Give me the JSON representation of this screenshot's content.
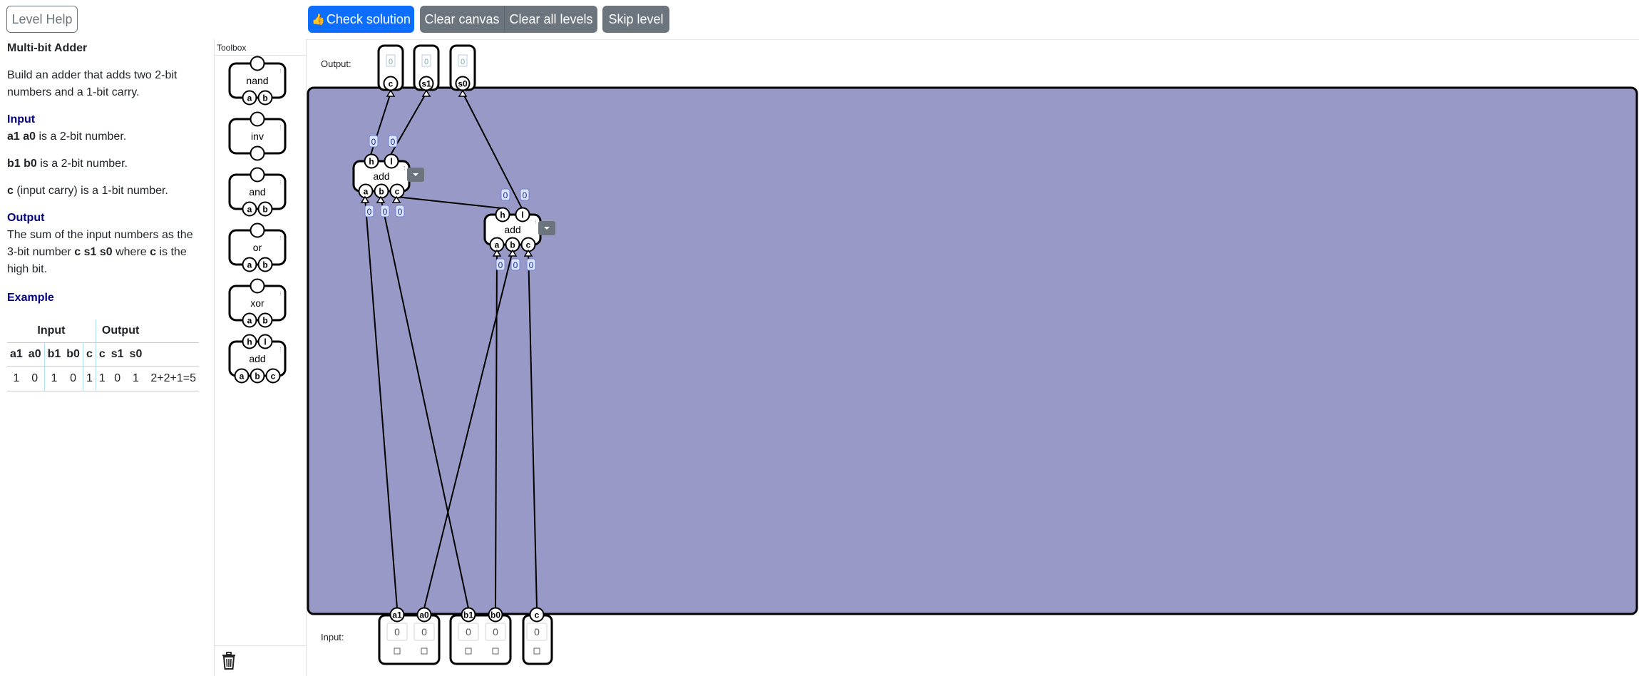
{
  "toolbar": {
    "help_label": "Level Help",
    "check_label": "Check solution",
    "clear_canvas_label": "Clear canvas",
    "clear_all_label": "Clear all levels",
    "skip_label": "Skip level"
  },
  "level": {
    "title": "Multi-bit Adder",
    "description": "Build an adder that adds two 2-bit numbers and a 1-bit carry.",
    "input_heading": "Input",
    "input_lines": [
      {
        "bold": "a1 a0",
        "rest": " is a 2-bit number."
      },
      {
        "bold": "b1 b0",
        "rest": " is a 2-bit number."
      },
      {
        "bold": "c",
        "rest": " (input carry) is a 1-bit number."
      }
    ],
    "output_heading": "Output",
    "output_text_1": "The sum of the input numbers as the 3-bit number ",
    "output_bold_1": "c s1 s0",
    "output_text_2": " where ",
    "output_bold_2": "c",
    "output_text_3": " is the high bit.",
    "example_heading": "Example",
    "example_group_input": "Input",
    "example_group_output": "Output",
    "example_columns": [
      "a1",
      "a0",
      "b1",
      "b0",
      "c",
      "c",
      "s1",
      "s0"
    ],
    "example_row": [
      "1",
      "0",
      "1",
      "0",
      "1",
      "1",
      "0",
      "1",
      "2+2+1=5"
    ]
  },
  "toolbox": {
    "title": "Toolbox",
    "gates": [
      {
        "name": "nand",
        "inputs": [
          "a",
          "b"
        ],
        "outputs": [
          ""
        ]
      },
      {
        "name": "inv",
        "inputs": [
          ""
        ],
        "outputs": [
          ""
        ]
      },
      {
        "name": "and",
        "inputs": [
          "a",
          "b"
        ],
        "outputs": [
          ""
        ]
      },
      {
        "name": "or",
        "inputs": [
          "a",
          "b"
        ],
        "outputs": [
          ""
        ]
      },
      {
        "name": "xor",
        "inputs": [
          "a",
          "b"
        ],
        "outputs": [
          ""
        ]
      },
      {
        "name": "add",
        "inputs": [
          "a",
          "b",
          "c"
        ],
        "outputs": [
          "h",
          "l"
        ]
      }
    ]
  },
  "canvas": {
    "output_label": "Output:",
    "input_label": "Input:",
    "outputs": [
      {
        "name": "c",
        "value": "0"
      },
      {
        "name": "s1",
        "value": "0"
      },
      {
        "name": "s0",
        "value": "0"
      }
    ],
    "input_groups": [
      {
        "pins": [
          {
            "name": "a1",
            "value": "0"
          },
          {
            "name": "a0",
            "value": "0"
          }
        ]
      },
      {
        "pins": [
          {
            "name": "b1",
            "value": "0"
          },
          {
            "name": "b0",
            "value": "0"
          }
        ]
      },
      {
        "pins": [
          {
            "name": "c",
            "value": "0"
          }
        ]
      }
    ],
    "placed_gates": [
      {
        "name": "add",
        "inputs": [
          "a",
          "b",
          "c"
        ],
        "outputs": [
          "h",
          "l"
        ]
      },
      {
        "name": "add",
        "inputs": [
          "a",
          "b",
          "c"
        ],
        "outputs": [
          "h",
          "l"
        ]
      }
    ],
    "wire_value": "0",
    "colors": {
      "board": "#9999c8",
      "accent": "#0d6efd",
      "secondary": "#6c757d",
      "heading": "#000080"
    }
  }
}
